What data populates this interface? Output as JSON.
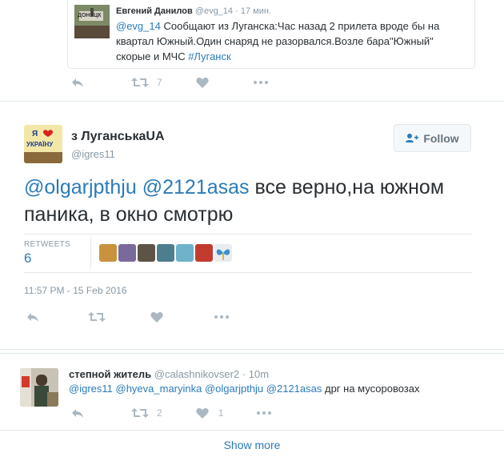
{
  "quoted_tweet": {
    "author_name": "Евгений Данилов",
    "author_handle": "@evg_14",
    "time": "17 мин.",
    "text_mention": "@evg_14",
    "text_body": " Сообщают из Луганска:Час назад 2 прилета вроде бы на квартал Южный.Один снаряд не разорвался.Возле бара\"Южный\" скорые и МЧС ",
    "text_hashtag": "#Луганск",
    "retweet_count": "7",
    "avatar_caption": "ДОНЕЦК"
  },
  "main_tweet": {
    "author_name": "з ЛуганськаUA",
    "author_handle": "@igres11",
    "avatar_text_top": "Я",
    "avatar_text_mid": "УКРАЇНУ",
    "follow_label": "Follow",
    "mention1": "@olgarjpthju",
    "mention2": "@2121asas",
    "body_text": " все верно,на южном паника, в окно смотрю",
    "retweets_label": "RETWEETS",
    "retweets_count": "6",
    "timestamp": "11:57 PM - 15 Feb 2016",
    "colors": {
      "accent": "#2b7bb9",
      "muted": "#8899a6",
      "icon": "#aab8c2"
    }
  },
  "reply_tweet": {
    "author_name": "степной житель",
    "author_handle": "@calashnikovser2",
    "time": "10m",
    "mention1": "@igres11",
    "mention2": "@hyeva_maryinka",
    "mention3": "@olgarjpthju",
    "mention4": "@2121asas",
    "body_text": " дрг на мусоровозах",
    "retweet_count": "2",
    "like_count": "1"
  },
  "footer": {
    "show_more": "Show more"
  }
}
